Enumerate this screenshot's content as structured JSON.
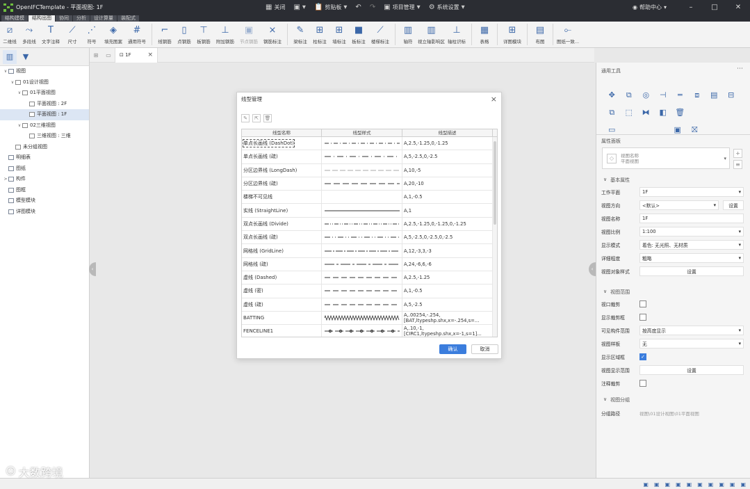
{
  "app": {
    "title": "OpenIFCTemplate - 平面视图: 1F",
    "close_label": "关闭",
    "clipboard_label": "剪贴板",
    "project_mgmt_label": "项目管理",
    "system_settings_label": "系统设置",
    "help_label": "帮助中心"
  },
  "ribbon_tabs": [
    "结构建模",
    "结构出图",
    "协同",
    "分析",
    "设计算量",
    "装配式"
  ],
  "ribbon": [
    {
      "label": "二维线",
      "icon": "line-icon",
      "glyph": "⧄"
    },
    {
      "label": "多段线",
      "icon": "polyline-icon",
      "glyph": "⤳"
    },
    {
      "label": "文字注释",
      "icon": "text-note-icon",
      "glyph": "T"
    },
    {
      "label": "尺寸",
      "icon": "dimension-icon",
      "glyph": "⟋"
    },
    {
      "label": "符号",
      "icon": "symbol-icon",
      "glyph": "⋰"
    },
    {
      "label": "填充图案",
      "icon": "fill-pattern-icon",
      "glyph": "◈"
    },
    {
      "label": "通用符号",
      "icon": "general-symbol-icon",
      "glyph": "#"
    },
    {
      "label": "线钢筋",
      "icon": "line-rebar-icon",
      "glyph": "⌐"
    },
    {
      "label": "点钢筋",
      "icon": "point-rebar-icon",
      "glyph": "▯"
    },
    {
      "label": "板钢筋",
      "icon": "slab-rebar-icon",
      "glyph": "⊤"
    },
    {
      "label": "附加钢筋",
      "icon": "extra-rebar-icon",
      "glyph": "⊥"
    },
    {
      "label": "节点钢筋",
      "icon": "node-rebar-icon",
      "glyph": "▣"
    },
    {
      "label": "钢筋标注",
      "icon": "rebar-label-icon",
      "glyph": "⨯"
    },
    {
      "label": "梁标注",
      "icon": "beam-label-icon",
      "glyph": "✎"
    },
    {
      "label": "柱标注",
      "icon": "column-label-icon",
      "glyph": "⊞"
    },
    {
      "label": "墙标注",
      "icon": "wall-label-icon",
      "glyph": "⊞"
    },
    {
      "label": "板标注",
      "icon": "slab-label-icon",
      "glyph": "■"
    },
    {
      "label": "楼梯标注",
      "icon": "stair-label-icon",
      "glyph": "⟋"
    },
    {
      "label": "轴符",
      "icon": "axis-symbol-icon",
      "glyph": "▥"
    },
    {
      "label": "视立轴影响区",
      "icon": "axis-zone-icon",
      "glyph": "▥"
    },
    {
      "label": "轴柱识标",
      "icon": "axis-column-icon",
      "glyph": "⊥"
    },
    {
      "label": "表格",
      "icon": "table-icon",
      "glyph": "▦"
    },
    {
      "label": "详图模块",
      "icon": "detail-module-icon",
      "glyph": "⊞"
    },
    {
      "label": "布图",
      "icon": "layout-icon",
      "glyph": "▤"
    },
    {
      "label": "图纸一致...",
      "icon": "sheet-check-icon",
      "glyph": "⟜"
    }
  ],
  "tree": [
    {
      "label": "视图",
      "depth": 0,
      "caret": "∨",
      "sel": false
    },
    {
      "label": "01设计视图",
      "depth": 1,
      "caret": "∨",
      "sel": false
    },
    {
      "label": "01平面视图",
      "depth": 2,
      "caret": "∨",
      "sel": false
    },
    {
      "label": "平面视图 : 2F",
      "depth": 3,
      "caret": "",
      "sel": false
    },
    {
      "label": "平面视图 : 1F",
      "depth": 3,
      "caret": "",
      "sel": true
    },
    {
      "label": "02三维视图",
      "depth": 2,
      "caret": "∨",
      "sel": false
    },
    {
      "label": "三维视图 : 三维",
      "depth": 3,
      "caret": "",
      "sel": false
    },
    {
      "label": "未分组视图",
      "depth": 1,
      "caret": "",
      "sel": false
    },
    {
      "label": "明细表",
      "depth": 0,
      "caret": "",
      "sel": false
    },
    {
      "label": "图纸",
      "depth": 0,
      "caret": "",
      "sel": false
    },
    {
      "label": "构件",
      "depth": 0,
      "caret": ">",
      "sel": false
    },
    {
      "label": "图框",
      "depth": 0,
      "caret": "",
      "sel": false
    },
    {
      "label": "模型模块",
      "depth": 0,
      "caret": "",
      "sel": false
    },
    {
      "label": "详图模块",
      "depth": 0,
      "caret": "",
      "sel": false
    }
  ],
  "doc_tab": "1F",
  "dialog": {
    "title": "线型管理",
    "headers": [
      "线型名称",
      "线型样式",
      "线型描述"
    ],
    "rows": [
      {
        "name": "单点长画线 (DashDot)",
        "pattern": "dashdot",
        "desc": "A,2.5,-1.25,0,-1.25"
      },
      {
        "name": "单点长画线 (疏)",
        "pattern": "dashdot2",
        "desc": "A,5,-2.5,0,-2.5"
      },
      {
        "name": "分区边界线 (LongDash)",
        "pattern": "longdashlight",
        "desc": "A,10,-5"
      },
      {
        "name": "分区边界线 (疏)",
        "pattern": "longdash",
        "desc": "A,20,-10"
      },
      {
        "name": "楼梯不可见线",
        "pattern": "none",
        "desc": "A,1,-0.5"
      },
      {
        "name": "实线 (StraightLine)",
        "pattern": "solid",
        "desc": "A,1"
      },
      {
        "name": "双点长画线 (Divide)",
        "pattern": "divide",
        "desc": "A,2.5,-1.25,0,-1.25,0,-1.25"
      },
      {
        "name": "双点长画线 (疏)",
        "pattern": "dividelight",
        "desc": "A,5,-2.5,0,-2.5,0,-2.5"
      },
      {
        "name": "网格线 (GridLine)",
        "pattern": "grid",
        "desc": "A,12,-3,3,-3"
      },
      {
        "name": "网格线 (疏)",
        "pattern": "grid2",
        "desc": "A,24,-6,6,-6"
      },
      {
        "name": "虚线 (Dashed)",
        "pattern": "dashed",
        "desc": "A,2.5,-1.25"
      },
      {
        "name": "虚线 (密)",
        "pattern": "dashed",
        "desc": "A,1,-0.5"
      },
      {
        "name": "虚线 (疏)",
        "pattern": "dashed",
        "desc": "A,5,-2.5"
      },
      {
        "name": "BATTING",
        "pattern": "batting",
        "desc": "A,.00254,-.254, [BAT,ltypeshp.shx,x=-.254,s=..."
      },
      {
        "name": "FENCELINE1",
        "pattern": "fence",
        "desc": "A,.10,-1, [CIRC1,ltypeshp.shx,x=-1,s=1]..."
      }
    ],
    "ok_label": "确认",
    "cancel_label": "取消"
  },
  "panel": {
    "tools_title": "通用工具",
    "tools": [
      "move-icon",
      "copy-icon",
      "rotate-icon",
      "align-icon",
      "offset-icon",
      "array-icon",
      "scale-icon",
      "trim-icon",
      "extend-icon",
      "split-icon",
      "mirror-icon",
      "pin-icon",
      "delete-icon",
      "measure-icon",
      "view-icon",
      "clean-icon"
    ],
    "props_title": "属性面板",
    "type_name": "视图名称",
    "type_sub": "平面视图",
    "basic_section": "基本属性",
    "props": [
      {
        "label": "工作平面",
        "value": "1F",
        "kind": "select"
      },
      {
        "label": "视图方向",
        "value": "<默认>",
        "kind": "select-btn",
        "btn": "设置"
      },
      {
        "label": "视图名称",
        "value": "1F",
        "kind": "text"
      },
      {
        "label": "视图比例",
        "value": "1:100",
        "kind": "select"
      },
      {
        "label": "显示模式",
        "value": "着色: 无光照、无材质",
        "kind": "select"
      },
      {
        "label": "详细程度",
        "value": "粗略",
        "kind": "select"
      },
      {
        "label": "视图对象样式",
        "value": "设置",
        "kind": "button"
      }
    ],
    "range_section": "视图范围",
    "range_props": [
      {
        "label": "视口裁剪",
        "kind": "check",
        "checked": false
      },
      {
        "label": "显示裁剪框",
        "kind": "check",
        "checked": false
      },
      {
        "label": "可见构件范围",
        "value": "按高度显示",
        "kind": "select"
      },
      {
        "label": "视图样板",
        "value": "无",
        "kind": "select"
      },
      {
        "label": "显示区域框",
        "kind": "check",
        "checked": true
      },
      {
        "label": "视图显示范围",
        "value": "设置",
        "kind": "button"
      },
      {
        "label": "注释裁剪",
        "kind": "check",
        "checked": false
      }
    ],
    "group_section": "视图分组",
    "group_label": "分组路径",
    "group_value": "视图\\01设计视图\\01平面视图"
  },
  "watermark": "大数跨境"
}
